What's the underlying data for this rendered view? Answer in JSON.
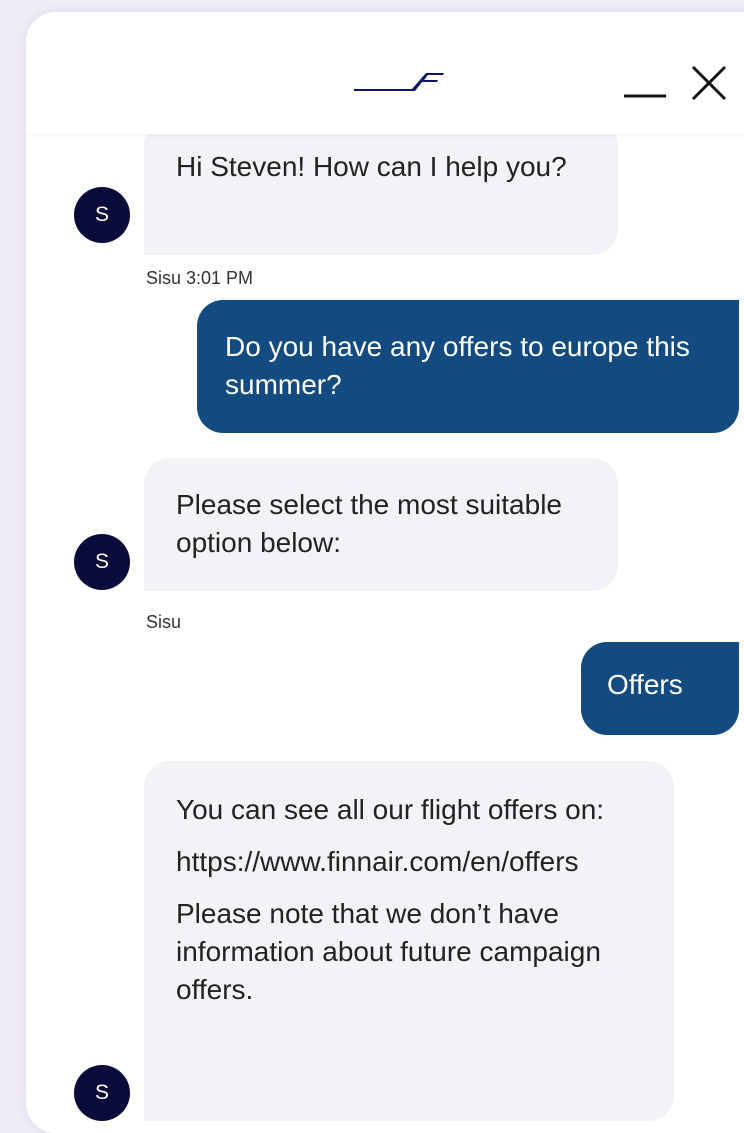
{
  "header": {
    "brand_logo": "finnair-logo",
    "minimize_icon": "minimize-icon",
    "close_icon": "close-icon",
    "logo_color": "#0b1560"
  },
  "avatar": {
    "letter": "S",
    "color": "#0b0b3b"
  },
  "messages": [
    {
      "sender": "bot",
      "text": "Hi Steven! How can I help you?",
      "meta": "Sisu 3:01 PM"
    },
    {
      "sender": "user",
      "text": "Do you have any offers to europe this summer?"
    },
    {
      "sender": "bot",
      "text": "Please select the most suitable option below:",
      "meta": "Sisu"
    },
    {
      "sender": "user",
      "text": "Offers"
    },
    {
      "sender": "bot",
      "paragraphs": [
        "You can see all our flight offers on:",
        "https://www.finnair.com/en/offers",
        "Please note that we don’t have information about future campaign offers."
      ]
    }
  ],
  "colors": {
    "user_bubble": "#134a80",
    "bot_bubble": "#f2f3f6",
    "background": "#f1edf8"
  }
}
